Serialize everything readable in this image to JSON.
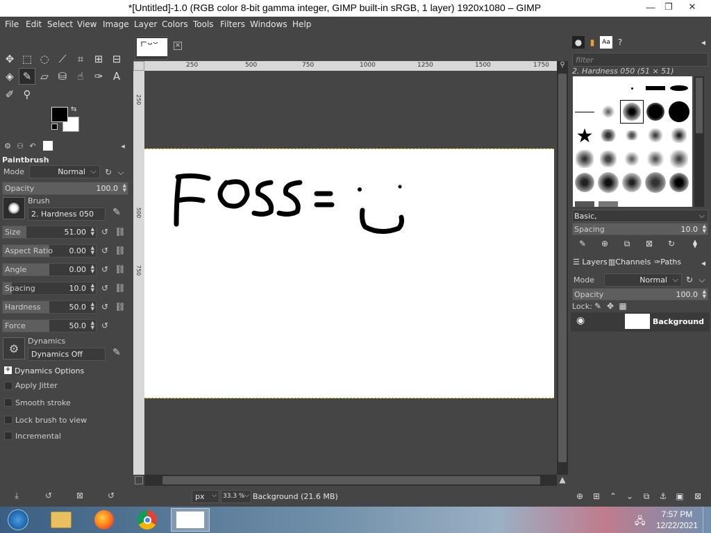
{
  "window": {
    "title": "*[Untitled]-1.0 (RGB color 8-bit gamma integer, GIMP built-in sRGB, 1 layer) 1920x1080 – GIMP",
    "minimize": "—",
    "restore": "❐",
    "close": "✕"
  },
  "menu": [
    "File",
    "Edit",
    "Select",
    "View",
    "Image",
    "Layer",
    "Colors",
    "Tools",
    "Filters",
    "Windows",
    "Help"
  ],
  "tool_options": {
    "title": "Paintbrush",
    "mode_label": "Mode",
    "mode_value": "Normal",
    "opacity": {
      "label": "Opacity",
      "value": "100.0",
      "fraction": 1.0
    },
    "brush_label": "Brush",
    "brush_value": "2. Hardness 050",
    "size": {
      "label": "Size",
      "value": "51.00",
      "fraction": 0.25
    },
    "aspect_ratio": {
      "label": "Aspect Ratio",
      "value": "0.00",
      "fraction": 0.5
    },
    "angle": {
      "label": "Angle",
      "value": "0.00",
      "fraction": 0.5
    },
    "spacing": {
      "label": "Spacing",
      "value": "10.0",
      "fraction": 0.1
    },
    "hardness": {
      "label": "Hardness",
      "value": "50.0",
      "fraction": 0.5
    },
    "force": {
      "label": "Force",
      "value": "50.0",
      "fraction": 0.5
    },
    "dynamics_label": "Dynamics",
    "dynamics_value": "Dynamics Off",
    "dynamics_options": "Dynamics Options",
    "apply_jitter": "Apply Jitter",
    "smooth_stroke": "Smooth stroke",
    "lock_brush": "Lock brush to view",
    "incremental": "Incremental"
  },
  "rulers": {
    "h_ticks": [
      "250",
      "500",
      "750",
      "1000",
      "1250",
      "1500",
      "1750"
    ],
    "v_ticks": [
      "250",
      "500",
      "750"
    ]
  },
  "canvas": {
    "drawn_text": "FOSS = ☺"
  },
  "status": {
    "unit": "px",
    "zoom": "33.3 %",
    "info": "Background (21.6 MB)"
  },
  "brushes": {
    "filter_placeholder": "filter",
    "current": "2. Hardness 050 (51 × 51)",
    "tag": "Basic,",
    "spacing_label": "Spacing",
    "spacing_value": "10.0"
  },
  "layers": {
    "tabs": [
      "Layers",
      "Channels",
      "Paths"
    ],
    "mode_label": "Mode",
    "mode_value": "Normal",
    "opacity_label": "Opacity",
    "opacity_value": "100.0",
    "lock_label": "Lock:",
    "layer_name": "Background"
  },
  "taskbar": {
    "time": "7:57 PM",
    "date": "12/22/2021"
  },
  "colors": {
    "fg": "#000000",
    "bg": "#ffffff"
  }
}
